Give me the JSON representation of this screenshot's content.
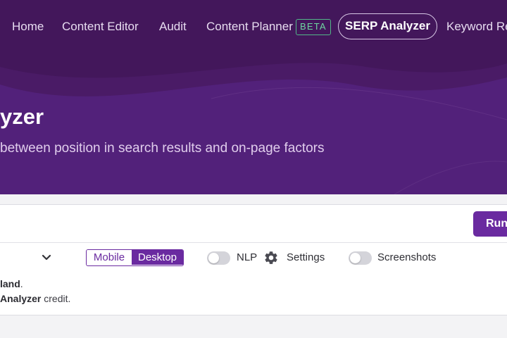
{
  "nav": {
    "items": [
      {
        "label": "Home"
      },
      {
        "label": "Content Editor"
      },
      {
        "label": "Audit"
      },
      {
        "label": "Content Planner"
      },
      {
        "label": "SERP Analyzer"
      },
      {
        "label": "Keyword Re"
      }
    ],
    "beta_badge": "BETA",
    "active_item": "SERP Analyzer"
  },
  "hero": {
    "title": "yzer",
    "subtitle": "between position in search results and on-page factors"
  },
  "query": {
    "value": "",
    "run_label": "Run"
  },
  "options": {
    "device": {
      "options": [
        "Mobile",
        "Desktop"
      ],
      "selected": "Desktop"
    },
    "nlp": {
      "label": "NLP",
      "enabled": false
    },
    "settings_label": "Settings",
    "screenshots": {
      "label": "Screenshots",
      "enabled": false
    }
  },
  "notes": {
    "line1_bold": "land",
    "line1_rest": ".",
    "line2_bold": "Analyzer",
    "line2_rest": " credit."
  },
  "colors": {
    "hero_bg": "#43175b",
    "accent": "#6a2aa0",
    "beta_green": "#52b788"
  },
  "icons": [
    "chevron-down-icon",
    "gear-icon"
  ]
}
